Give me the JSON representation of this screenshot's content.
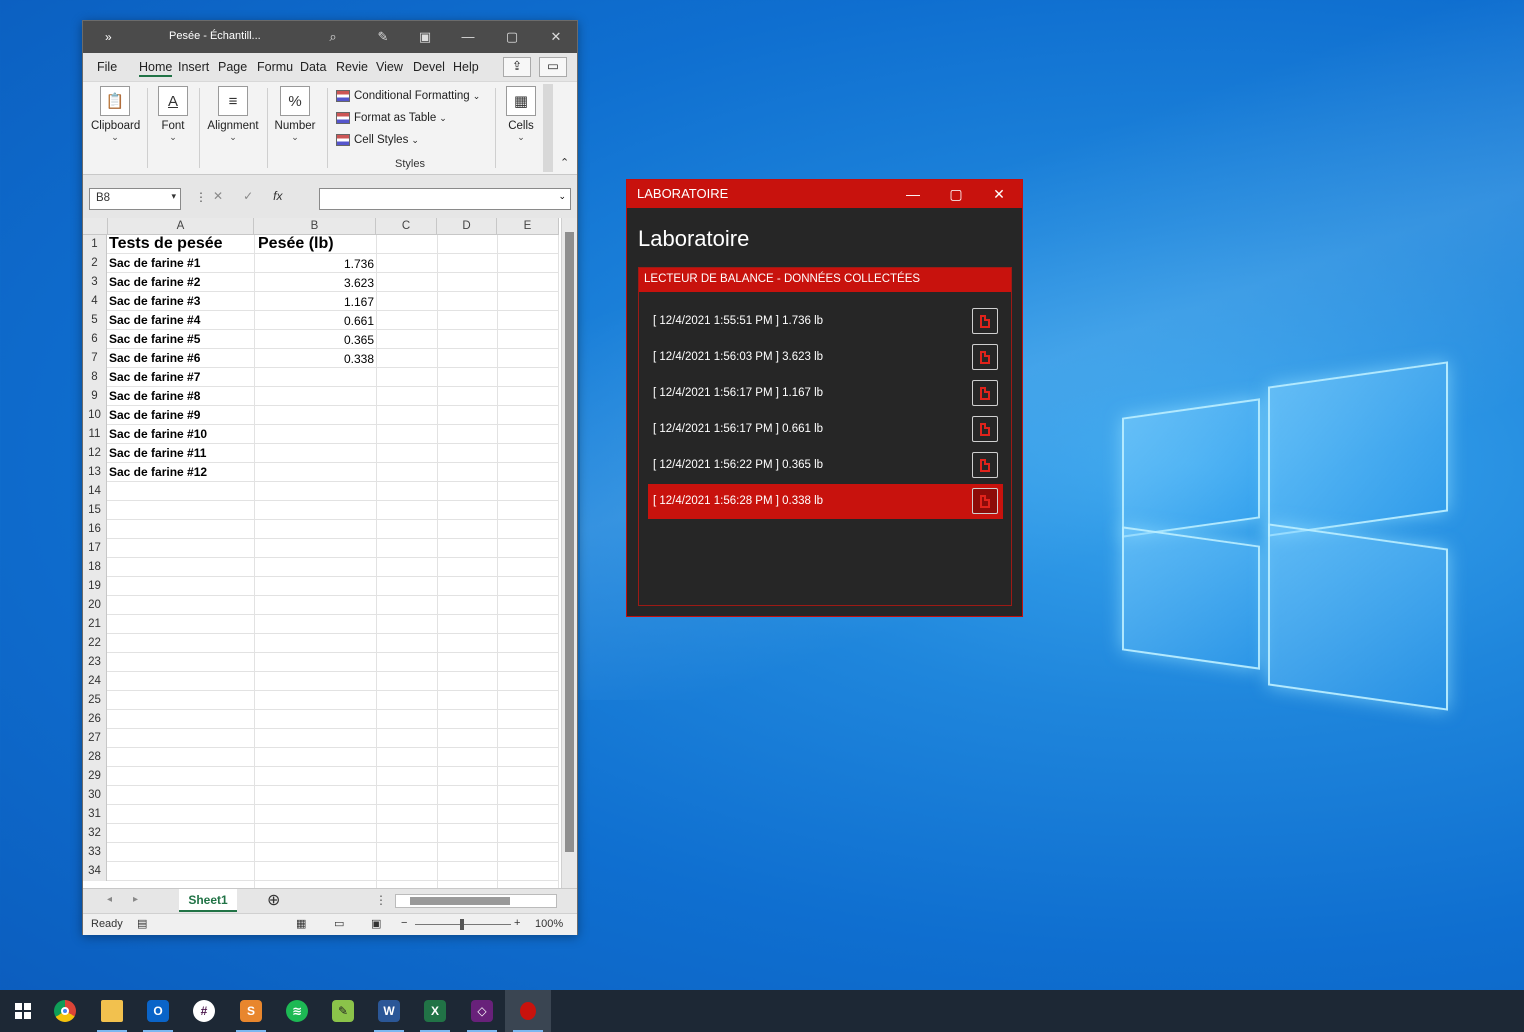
{
  "excel": {
    "title": "Pesée - Échantill...",
    "tabs": [
      "File",
      "Home",
      "Insert",
      "Page",
      "Formu",
      "Data",
      "Revie",
      "View",
      "Devel",
      "Help"
    ],
    "ribbon": {
      "clipboard": "Clipboard",
      "font": "Font",
      "alignment": "Alignment",
      "number": "Number",
      "conditional_formatting": "Conditional Formatting",
      "format_as_table": "Format as Table",
      "cell_styles": "Cell Styles",
      "styles": "Styles",
      "cells": "Cells"
    },
    "name_box": "B8",
    "columns": [
      "A",
      "B",
      "C",
      "D",
      "E"
    ],
    "rows": [
      {
        "n": "1",
        "a": "Tests de pesée",
        "b": "Pesée (lb)"
      },
      {
        "n": "2",
        "a": "Sac de farine #1",
        "b": "1.736"
      },
      {
        "n": "3",
        "a": "Sac de farine #2",
        "b": "3.623"
      },
      {
        "n": "4",
        "a": "Sac de farine #3",
        "b": "1.167"
      },
      {
        "n": "5",
        "a": "Sac de farine #4",
        "b": "0.661"
      },
      {
        "n": "6",
        "a": "Sac de farine #5",
        "b": "0.365"
      },
      {
        "n": "7",
        "a": "Sac de farine #6",
        "b": "0.338"
      },
      {
        "n": "8",
        "a": "Sac de farine #7",
        "b": ""
      },
      {
        "n": "9",
        "a": "Sac de farine #8",
        "b": ""
      },
      {
        "n": "10",
        "a": "Sac de farine #9",
        "b": ""
      },
      {
        "n": "11",
        "a": "Sac de farine #10",
        "b": ""
      },
      {
        "n": "12",
        "a": "Sac de farine #11",
        "b": ""
      },
      {
        "n": "13",
        "a": "Sac de farine #12",
        "b": ""
      },
      {
        "n": "14",
        "a": "",
        "b": ""
      },
      {
        "n": "15",
        "a": "",
        "b": ""
      },
      {
        "n": "16",
        "a": "",
        "b": ""
      },
      {
        "n": "17",
        "a": "",
        "b": ""
      },
      {
        "n": "18",
        "a": "",
        "b": ""
      },
      {
        "n": "19",
        "a": "",
        "b": ""
      },
      {
        "n": "20",
        "a": "",
        "b": ""
      },
      {
        "n": "21",
        "a": "",
        "b": ""
      },
      {
        "n": "22",
        "a": "",
        "b": ""
      },
      {
        "n": "23",
        "a": "",
        "b": ""
      },
      {
        "n": "24",
        "a": "",
        "b": ""
      },
      {
        "n": "25",
        "a": "",
        "b": ""
      },
      {
        "n": "26",
        "a": "",
        "b": ""
      },
      {
        "n": "27",
        "a": "",
        "b": ""
      },
      {
        "n": "28",
        "a": "",
        "b": ""
      },
      {
        "n": "29",
        "a": "",
        "b": ""
      },
      {
        "n": "30",
        "a": "",
        "b": ""
      },
      {
        "n": "31",
        "a": "",
        "b": ""
      },
      {
        "n": "32",
        "a": "",
        "b": ""
      },
      {
        "n": "33",
        "a": "",
        "b": ""
      },
      {
        "n": "34",
        "a": "",
        "b": ""
      }
    ],
    "sheet_tab": "Sheet1",
    "status": "Ready",
    "zoom": "100%"
  },
  "lab": {
    "title": "LABORATOIRE",
    "heading": "Laboratoire",
    "panel_header": "LECTEUR DE BALANCE - DONNÉES COLLECTÉES",
    "readings": [
      "[ 12/4/2021 1:55:51 PM ] 1.736 lb",
      "[ 12/4/2021 1:56:03 PM ] 3.623 lb",
      "[ 12/4/2021 1:56:17 PM ] 1.167 lb",
      "[ 12/4/2021 1:56:17 PM ] 0.661 lb",
      "[ 12/4/2021 1:56:22 PM ] 0.365 lb",
      "[ 12/4/2021 1:56:28 PM ] 0.338 lb"
    ],
    "selected_index": 5,
    "accent": "#c8120d"
  },
  "taskbar": {
    "icons": [
      "windows-start-icon",
      "chrome-icon",
      "file-explorer-icon",
      "outlook-icon",
      "slack-icon",
      "sublime-text-icon",
      "spotify-icon",
      "notepad-plus-plus-icon",
      "word-icon",
      "excel-icon",
      "visual-studio-icon",
      "laboratoire-app-icon"
    ]
  }
}
